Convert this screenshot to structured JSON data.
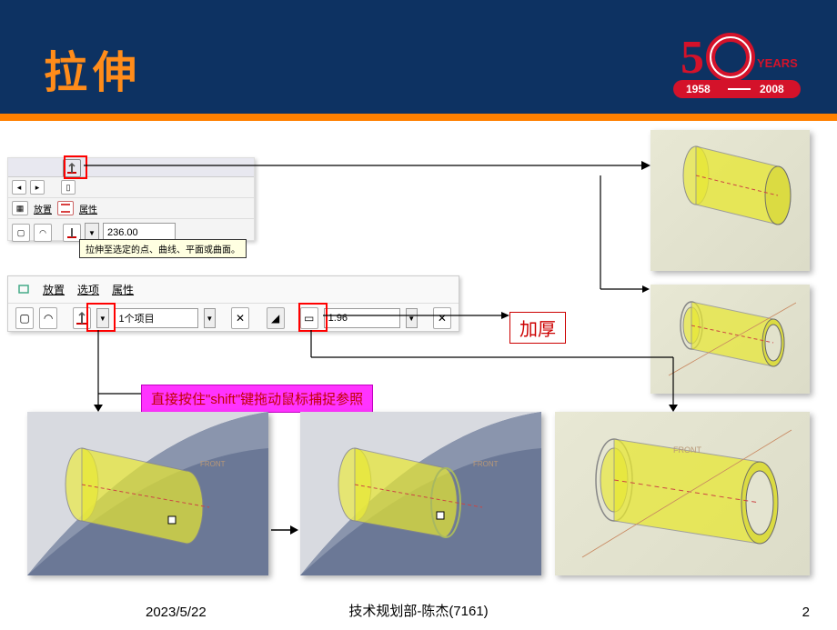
{
  "header": {
    "title": "拉伸"
  },
  "logo": {
    "years_text": "YEARS",
    "year_from": "1958",
    "year_to": "2008",
    "big_digit": "5",
    "zero_digit": "0"
  },
  "panel1": {
    "tab_place_icon": "▦",
    "tab_place": "放置",
    "tab_prop": "属性",
    "value": "236.00",
    "tooltip": "拉伸至选定的点、曲线、平面或曲面。"
  },
  "panel2": {
    "tab_place": "放置",
    "tab_options": "选项",
    "tab_props": "属性",
    "dropdown1": "1个项目",
    "dropdown2": "1.96"
  },
  "labels": {
    "thicken": "加厚",
    "shift_tip": "直接按住\"shift\"键拖动鼠标捕捉参照"
  },
  "footer": {
    "date": "2023/5/22",
    "dept": "技术规划部-陈杰(7161)",
    "page": "2"
  },
  "images": {
    "front_label": "FRONT"
  }
}
